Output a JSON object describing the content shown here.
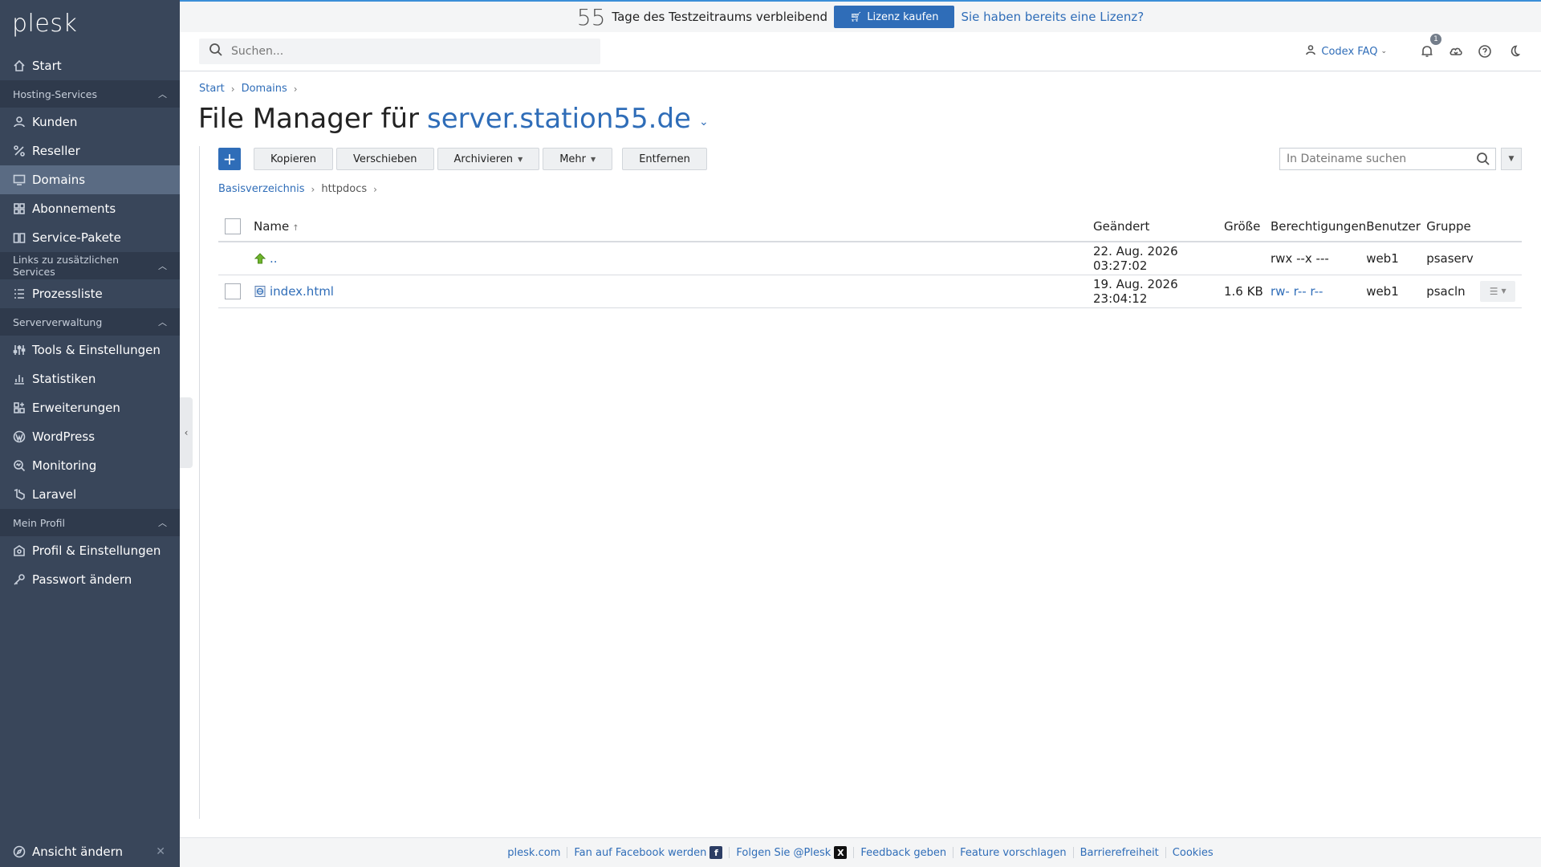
{
  "app": {
    "logo": "plesk"
  },
  "banner": {
    "trial_days": "55",
    "trial_text": "Tage des Testzeitraums verbleibend",
    "buy_label": "Lizenz kaufen",
    "license_link": "Sie haben bereits eine Lizenz?"
  },
  "header": {
    "search_placeholder": "Suchen...",
    "user": "Codex FAQ",
    "notifications_count": "1"
  },
  "sidebar": {
    "items": [
      {
        "label": "Start",
        "icon": "home-icon"
      },
      {
        "section": "Hosting-Services"
      },
      {
        "label": "Kunden",
        "icon": "user-icon"
      },
      {
        "label": "Reseller",
        "icon": "percent-icon"
      },
      {
        "label": "Domains",
        "icon": "monitor-icon",
        "active": true
      },
      {
        "label": "Abonnements",
        "icon": "grid-icon"
      },
      {
        "label": "Service-Pakete",
        "icon": "book-icon"
      },
      {
        "section": "Links zu zusätzlichen Services"
      },
      {
        "label": "Prozessliste",
        "icon": "list-icon"
      },
      {
        "section": "Serververwaltung"
      },
      {
        "label": "Tools & Einstellungen",
        "icon": "sliders-icon"
      },
      {
        "label": "Statistiken",
        "icon": "bar-chart-icon"
      },
      {
        "label": "Erweiterungen",
        "icon": "extensions-icon"
      },
      {
        "label": "WordPress",
        "icon": "wordpress-icon"
      },
      {
        "label": "Monitoring",
        "icon": "monitoring-icon"
      },
      {
        "label": "Laravel",
        "icon": "laravel-icon"
      },
      {
        "section": "Mein Profil"
      },
      {
        "label": "Profil & Einstellungen",
        "icon": "profile-icon"
      },
      {
        "label": "Passwort ändern",
        "icon": "key-icon"
      }
    ],
    "bottom_label": "Ansicht ändern"
  },
  "breadcrumb": [
    "Start",
    "Domains"
  ],
  "page": {
    "title": "File Manager für",
    "domain": "server.station55.de"
  },
  "toolbar": {
    "copy": "Kopieren",
    "move": "Verschieben",
    "archive": "Archivieren",
    "more": "Mehr",
    "remove": "Entfernen",
    "file_search_placeholder": "In Dateiname suchen"
  },
  "path": {
    "root": "Basisverzeichnis",
    "current": "httpdocs"
  },
  "table": {
    "headers": {
      "name": "Name",
      "modified": "Geändert",
      "size": "Größe",
      "permissions": "Berechtigungen",
      "user": "Benutzer",
      "group": "Gruppe"
    },
    "rows": [
      {
        "name": "..",
        "modified": "22. Aug. 2026 03:27:02",
        "size": "",
        "permissions": "rwx --x ---",
        "user": "web1",
        "group": "psaserv"
      },
      {
        "name": "index.html",
        "modified": "19. Aug. 2026 23:04:12",
        "size": "1.6 KB",
        "permissions": "rw- r-- r--",
        "user": "web1",
        "group": "psacln"
      }
    ]
  },
  "footer": {
    "links": [
      "plesk.com",
      "Fan auf Facebook werden",
      "Folgen Sie @Plesk",
      "Feedback geben",
      "Feature vorschlagen",
      "Barrierefreiheit",
      "Cookies"
    ]
  },
  "colors": {
    "sidebar": "#39465a",
    "accent": "#2f6db8",
    "active_item": "#5a6b83"
  }
}
